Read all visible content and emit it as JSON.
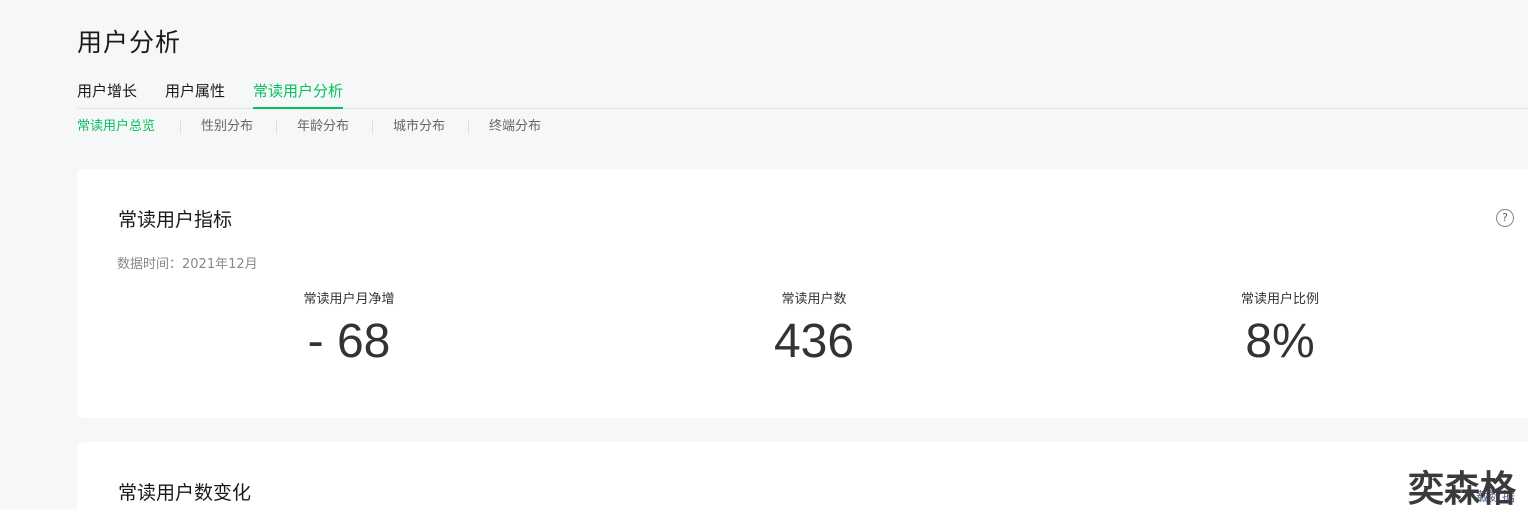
{
  "page": {
    "title": "用户分析"
  },
  "tabs": [
    {
      "label": "用户增长"
    },
    {
      "label": "用户属性"
    },
    {
      "label": "常读用户分析"
    }
  ],
  "subtabs": [
    {
      "label": "常读用户总览"
    },
    {
      "label": "性别分布"
    },
    {
      "label": "年龄分布"
    },
    {
      "label": "城市分布"
    },
    {
      "label": "终端分布"
    }
  ],
  "metrics_card": {
    "title": "常读用户指标",
    "data_time": "数据时间：2021年12月",
    "help_icon": "question-circle-icon",
    "metrics": [
      {
        "label": "常读用户月净增",
        "value": "- 68"
      },
      {
        "label": "常读用户数",
        "value": "436"
      },
      {
        "label": "常读用户比例",
        "value": "8%"
      }
    ]
  },
  "change_card": {
    "title": "常读用户数变化",
    "download_label": "下载数据"
  },
  "watermark": {
    "text": "奕森格"
  },
  "colors": {
    "accent": "#07c160",
    "background": "#f6f7f8",
    "card": "#ffffff"
  }
}
